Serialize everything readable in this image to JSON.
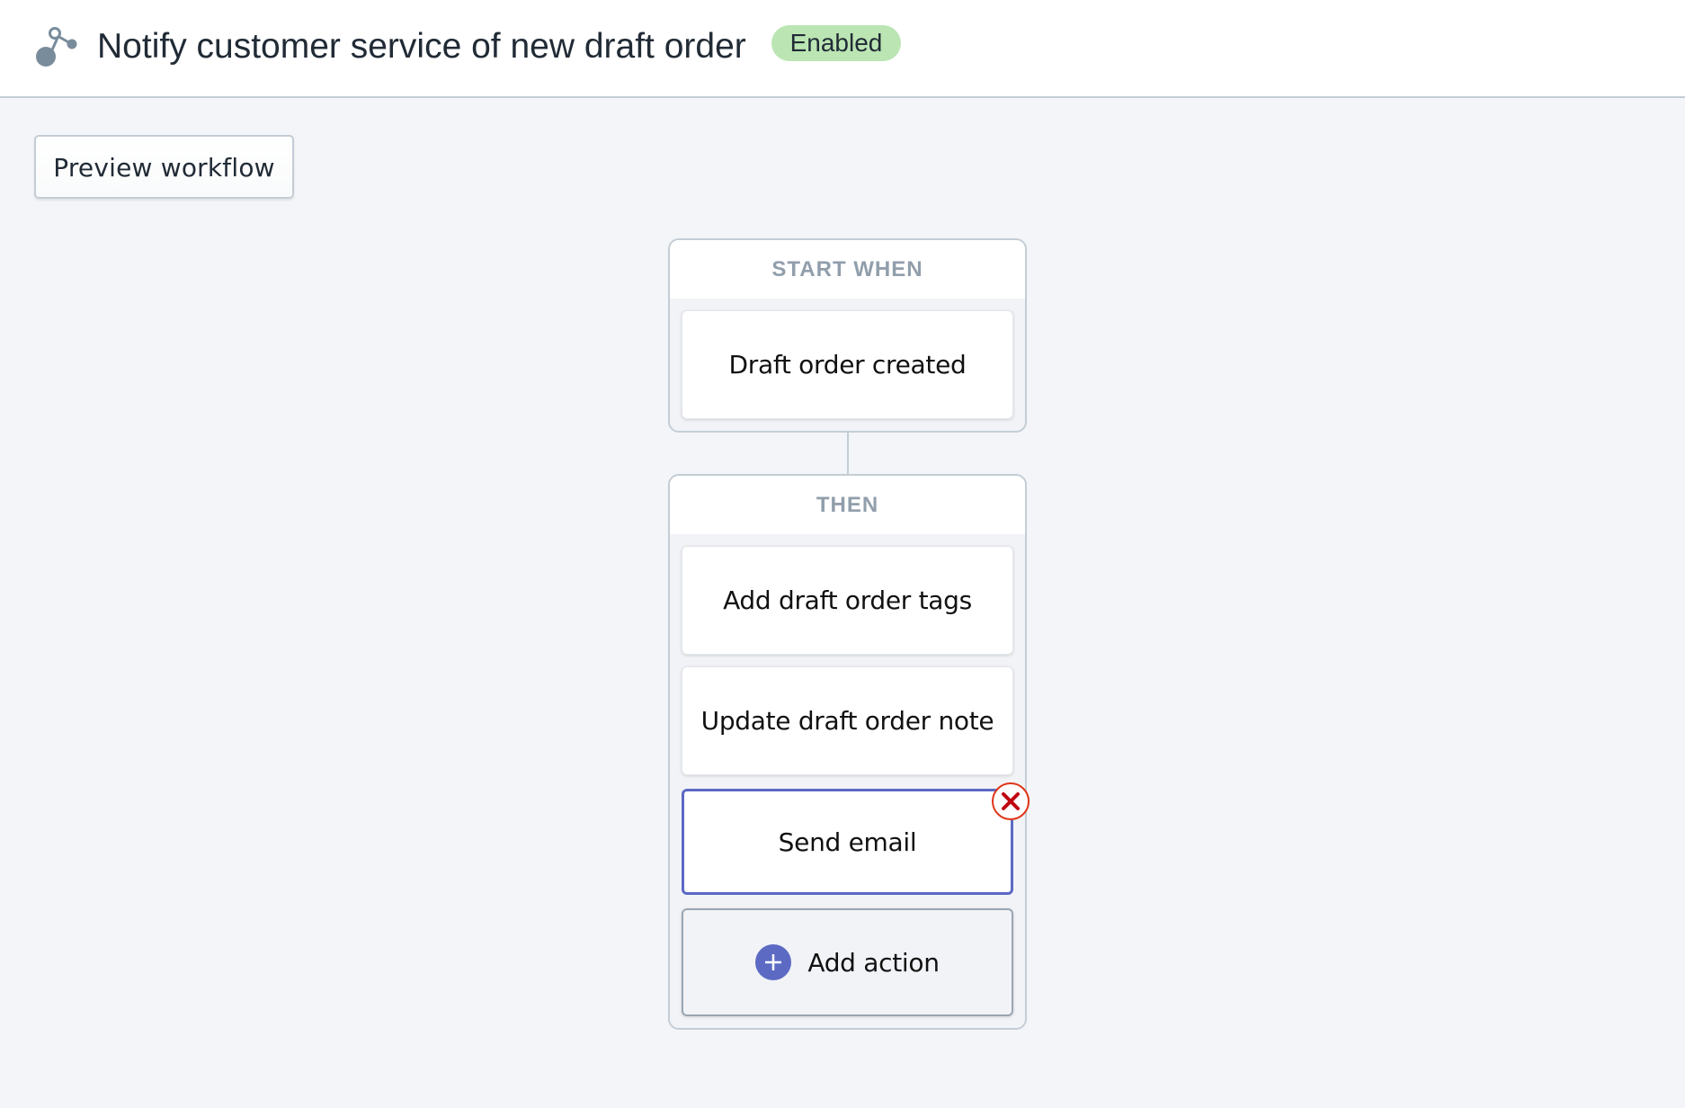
{
  "header": {
    "icon": "workflow-icon",
    "title": "Notify customer service of new draft order",
    "status": "Enabled",
    "status_color": "#bbe5b3"
  },
  "toolbar": {
    "preview_label": "Preview workflow"
  },
  "workflow": {
    "trigger_section": {
      "heading": "START WHEN",
      "trigger": "Draft order created"
    },
    "action_section": {
      "heading": "THEN",
      "actions": [
        {
          "label": "Add draft order tags"
        },
        {
          "label": "Update draft order note"
        },
        {
          "label": "Send email",
          "selected": true
        }
      ],
      "remove_icon": "close-icon",
      "add_action_label": "Add action",
      "add_icon": "plus-circle-icon"
    }
  },
  "colors": {
    "accent": "#5c6ac4",
    "error": "#de3618",
    "border": "#c4cdd5",
    "background": "#f4f5f8"
  }
}
